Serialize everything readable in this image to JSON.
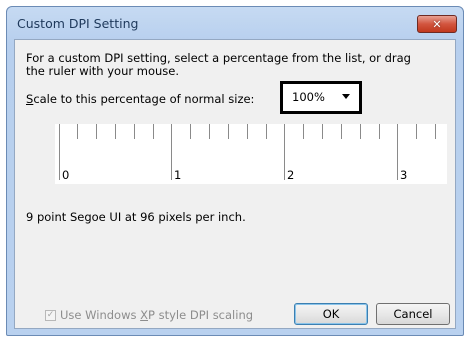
{
  "window": {
    "title": "Custom DPI Setting",
    "close_symbol": "✕"
  },
  "instructions": "For a custom DPI setting, select a percentage from the list, or drag the ruler with your mouse.",
  "scale": {
    "label_accel": "S",
    "label_rest": "cale to this percentage of normal size:",
    "selected_value": "100%"
  },
  "ruler": {
    "labels": [
      "0",
      "1",
      "2",
      "3"
    ]
  },
  "description": "9 point Segoe UI at 96 pixels per inch.",
  "xp_option": {
    "label_before": "Use Windows ",
    "label_accel": "X",
    "label_after": "P style DPI scaling",
    "checked": true,
    "enabled": false,
    "check_glyph": "✓"
  },
  "buttons": {
    "ok": "OK",
    "cancel": "Cancel"
  },
  "colors": {
    "title_bar": "#b9d1ef",
    "close_button": "#c1381e",
    "dialog_body": "#f0f0f0",
    "highlight_border": "#000000",
    "ok_border": "#3c7fb1"
  },
  "icons": {
    "close": "close-icon",
    "dropdown": "chevron-down-icon",
    "check": "checkmark-icon"
  }
}
